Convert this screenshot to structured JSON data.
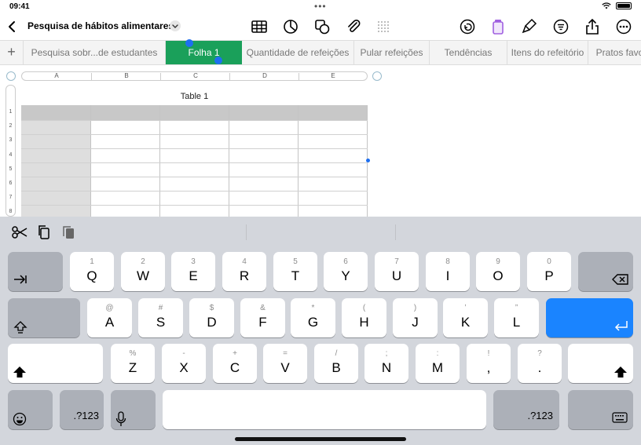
{
  "status": {
    "time": "09:41"
  },
  "document": {
    "title": "Pesquisa de hábitos alimentares"
  },
  "toolbar": {
    "icons": [
      "table-icon",
      "chart-icon",
      "shapes-icon",
      "attachment-icon",
      "grid-icon",
      "undo-icon",
      "format-brush-icon",
      "paint-icon",
      "filter-icon",
      "share-icon",
      "more-icon"
    ]
  },
  "tabs": [
    {
      "label": "Pesquisa sobr...de estudantes",
      "active": false
    },
    {
      "label": "Folha 1",
      "active": true
    },
    {
      "label": "Quantidade de refeições",
      "active": false
    },
    {
      "label": "Pular refeições",
      "active": false
    },
    {
      "label": "Tendências",
      "active": false
    },
    {
      "label": "Itens do refeitório",
      "active": false
    },
    {
      "label": "Pratos favo",
      "active": false
    }
  ],
  "add_sheet": "+",
  "columns": [
    "A",
    "B",
    "C",
    "D",
    "E"
  ],
  "rows": [
    "1",
    "2",
    "3",
    "4",
    "5",
    "6",
    "7",
    "8"
  ],
  "table": {
    "title": "Table 1"
  },
  "keyboard": {
    "row1": [
      {
        "k": "Q",
        "s": "1"
      },
      {
        "k": "W",
        "s": "2"
      },
      {
        "k": "E",
        "s": "3"
      },
      {
        "k": "R",
        "s": "4"
      },
      {
        "k": "T",
        "s": "5"
      },
      {
        "k": "Y",
        "s": "6"
      },
      {
        "k": "U",
        "s": "7"
      },
      {
        "k": "I",
        "s": "8"
      },
      {
        "k": "O",
        "s": "9"
      },
      {
        "k": "P",
        "s": "0"
      }
    ],
    "row2": [
      {
        "k": "A",
        "s": "@"
      },
      {
        "k": "S",
        "s": "#"
      },
      {
        "k": "D",
        "s": "$"
      },
      {
        "k": "F",
        "s": "&"
      },
      {
        "k": "G",
        "s": "*"
      },
      {
        "k": "H",
        "s": "("
      },
      {
        "k": "J",
        "s": ")"
      },
      {
        "k": "K",
        "s": "’"
      },
      {
        "k": "L",
        "s": "”"
      }
    ],
    "row3": [
      {
        "k": "Z",
        "s": "%"
      },
      {
        "k": "X",
        "s": "-"
      },
      {
        "k": "C",
        "s": "+"
      },
      {
        "k": "V",
        "s": "="
      },
      {
        "k": "B",
        "s": "/"
      },
      {
        "k": "N",
        "s": ";"
      },
      {
        "k": "M",
        "s": ":"
      }
    ],
    "punct": [
      {
        "k": ",",
        "s": "!"
      },
      {
        "k": ".",
        "s": "?"
      }
    ],
    "numbers_label": ".?123"
  }
}
